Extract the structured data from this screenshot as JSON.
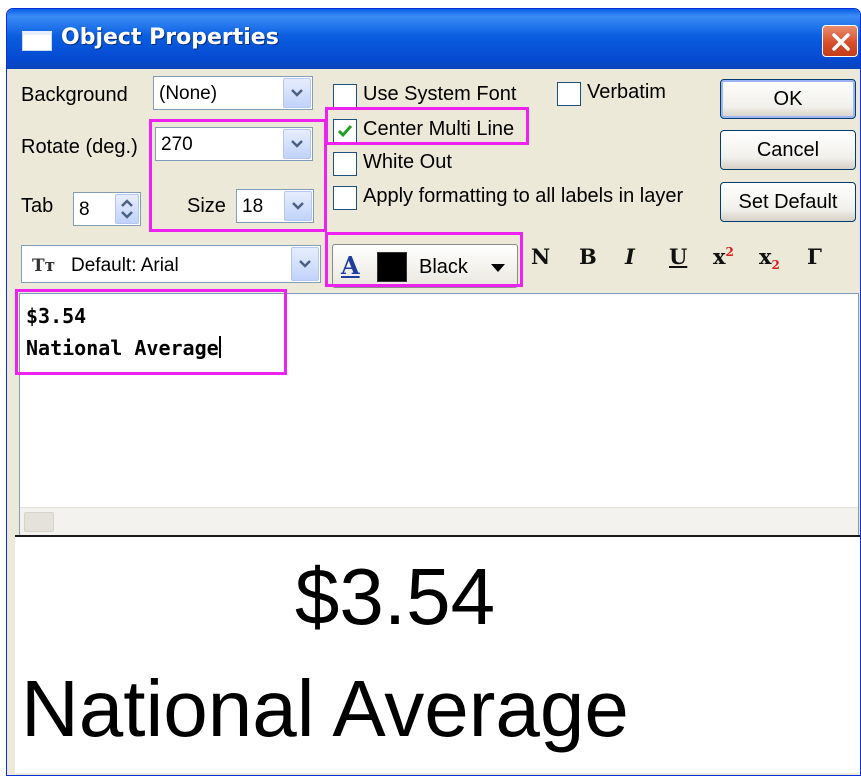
{
  "window": {
    "title": "Object Properties",
    "close_label": "✕"
  },
  "form": {
    "background_label": "Background",
    "background_value": "(None)",
    "rotate_label": "Rotate (deg.)",
    "rotate_value": "270",
    "tab_label": "Tab",
    "tab_value": "8",
    "size_label": "Size",
    "size_value": "18"
  },
  "options": {
    "use_system_font": {
      "label": "Use System Font",
      "checked": false
    },
    "verbatim": {
      "label": "Verbatim",
      "checked": false
    },
    "center_multi_line": {
      "label": "Center Multi Line",
      "checked": true
    },
    "white_out": {
      "label": "White Out",
      "checked": false
    },
    "apply_formatting": {
      "label": "Apply formatting to all labels in layer",
      "checked": false
    }
  },
  "buttons": {
    "ok": "OK",
    "cancel": "Cancel",
    "set_default": "Set Default"
  },
  "font": {
    "icon": "Tт",
    "name": "Default: Arial"
  },
  "color": {
    "a_glyph": "A",
    "name": "Black",
    "swatch": "#000000"
  },
  "format_buttons": {
    "normal": "N",
    "bold": "B",
    "italic": "I",
    "underline": "U",
    "superscript": "x",
    "superscript_mark": "2",
    "subscript": "x",
    "subscript_mark": "2",
    "greek": "Γ"
  },
  "editor": {
    "lines": [
      "$3.54",
      "National Average"
    ]
  },
  "preview": {
    "line1": "$3.54",
    "line2": "National Average"
  },
  "colors": {
    "highlight": "#EE22EE",
    "title_bar": "#0A5EE0",
    "dialog_bg": "#ECE9D8"
  }
}
